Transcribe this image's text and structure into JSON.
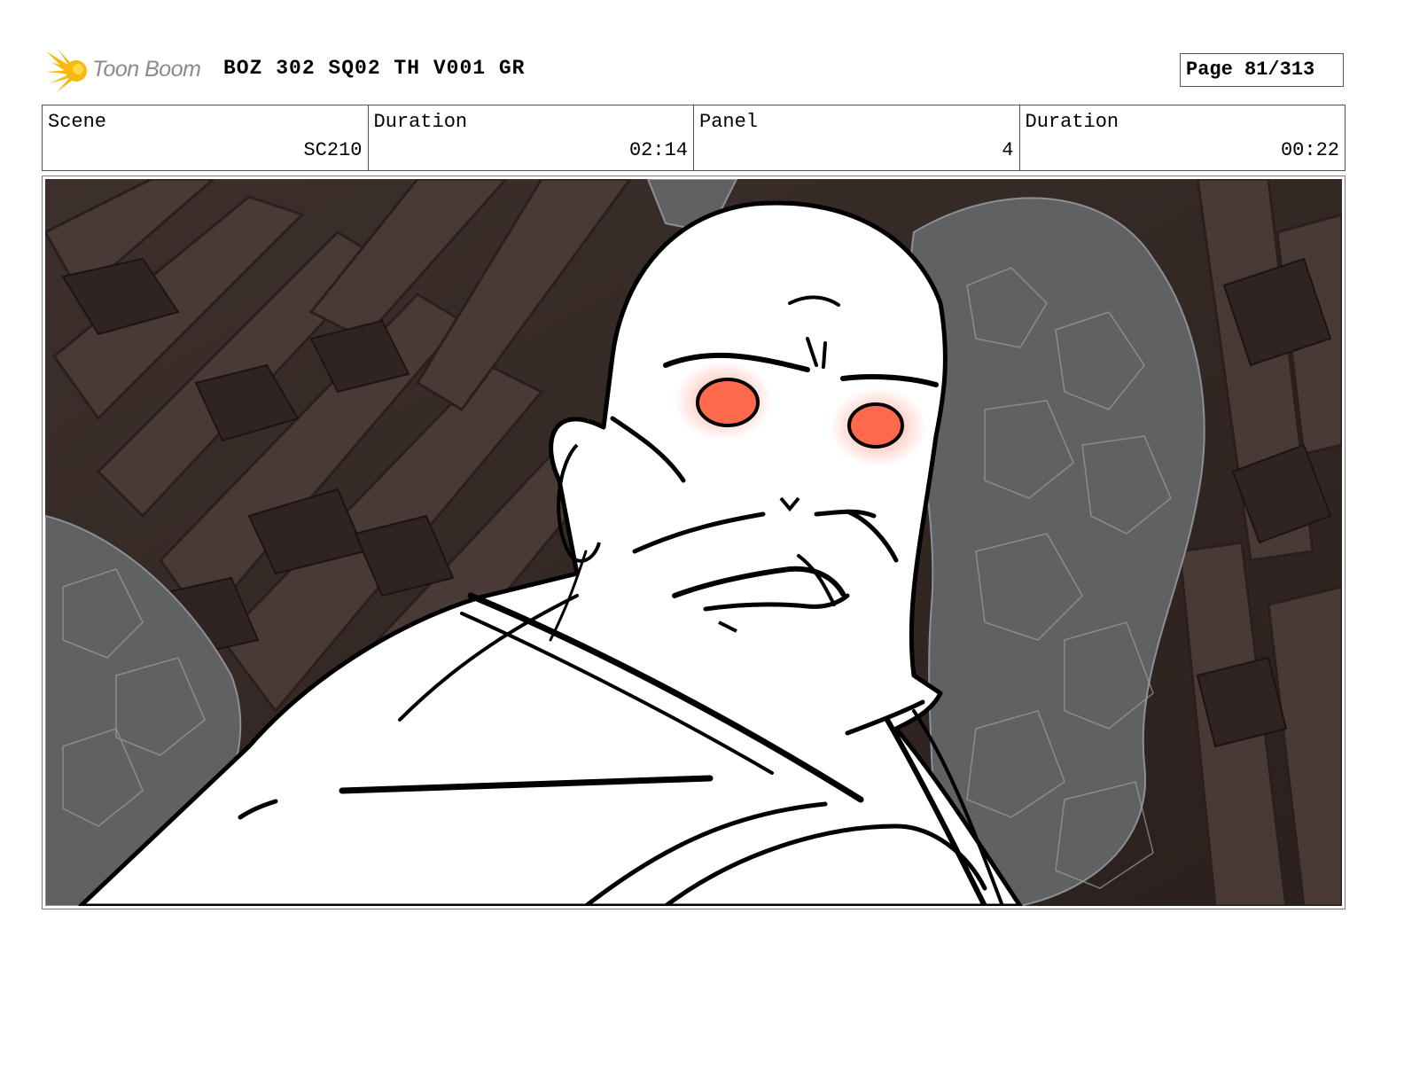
{
  "header": {
    "logo_text": "Toon Boom",
    "logo_icon": "sunburst-icon",
    "title": "BOZ 302 SQ02 TH V001 GR",
    "page": "Page  81/313"
  },
  "info": [
    {
      "label": "Scene",
      "value": "SC210"
    },
    {
      "label": "Duration",
      "value": "02:14"
    },
    {
      "label": "Panel",
      "value": "4"
    },
    {
      "label": "Duration",
      "value": "00:22"
    }
  ],
  "colors": {
    "rock_dark": "#3a2c28",
    "rock_grey": "#5d5f61",
    "eye_glow": "#ff6a4d",
    "logo_yellow": "#f5b90f"
  }
}
